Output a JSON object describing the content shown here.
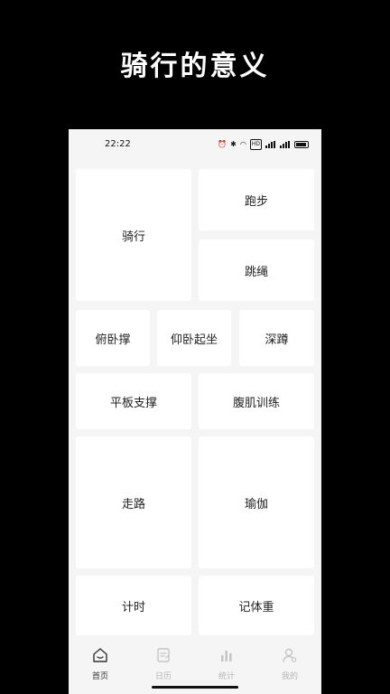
{
  "promo": {
    "title": "骑行的意义"
  },
  "status_bar": {
    "time": "22:22",
    "hd_badge": "HD"
  },
  "tiles": {
    "cycling": "骑行",
    "running": "跑步",
    "jump_rope": "跳绳",
    "pushup": "俯卧撑",
    "situp": "仰卧起坐",
    "squat": "深蹲",
    "plank": "平板支撑",
    "abs": "腹肌训练",
    "walking": "走路",
    "yoga": "瑜伽",
    "timer": "计时",
    "weight_log": "记体重"
  },
  "tabbar": {
    "items": [
      {
        "label": "首页",
        "icon": "home-icon",
        "active": true
      },
      {
        "label": "日历",
        "icon": "calendar-icon",
        "active": false
      },
      {
        "label": "统计",
        "icon": "stats-icon",
        "active": false
      },
      {
        "label": "我的",
        "icon": "profile-icon",
        "active": false
      }
    ]
  },
  "colors": {
    "background": "#000000",
    "screen": "#f5f5f5",
    "tile": "#ffffff",
    "inactive_tab": "#b5b5b5"
  }
}
